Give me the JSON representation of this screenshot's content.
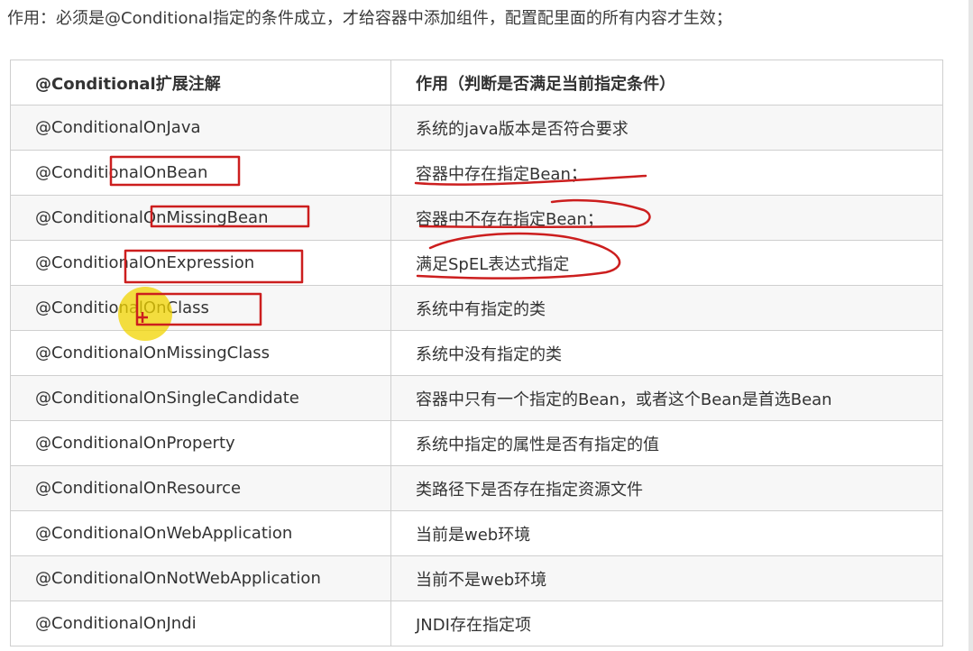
{
  "intro_text": "作用：必须是@Conditional指定的条件成立，才给容器中添加组件，配置配里面的所有内容才生效；",
  "table": {
    "headers": [
      "@Conditional扩展注解",
      "作用（判断是否满足当前指定条件）"
    ],
    "rows": [
      [
        "@ConditionalOnJava",
        "系统的java版本是否符合要求"
      ],
      [
        "@ConditionalOnBean",
        "容器中存在指定Bean；"
      ],
      [
        "@ConditionalOnMissingBean",
        "容器中不存在指定Bean；"
      ],
      [
        "@ConditionalOnExpression",
        "满足SpEL表达式指定"
      ],
      [
        "@ConditionalOnClass",
        "系统中有指定的类"
      ],
      [
        "@ConditionalOnMissingClass",
        "系统中没有指定的类"
      ],
      [
        "@ConditionalOnSingleCandidate",
        "容器中只有一个指定的Bean，或者这个Bean是首选Bean"
      ],
      [
        "@ConditionalOnProperty",
        "系统中指定的属性是否有指定的值"
      ],
      [
        "@ConditionalOnResource",
        "类路径下是否存在指定资源文件"
      ],
      [
        "@ConditionalOnWebApplication",
        "当前是web环境"
      ],
      [
        "@ConditionalOnNotWebApplication",
        "当前不是web环境"
      ],
      [
        "@ConditionalOnJndi",
        "JNDI存在指定项"
      ]
    ]
  },
  "colors": {
    "annotation_red": "#cc1e1e",
    "cursor_highlight": "#f2d400",
    "row_stripe": "#f7f7f7",
    "border": "#cfcfcf"
  }
}
